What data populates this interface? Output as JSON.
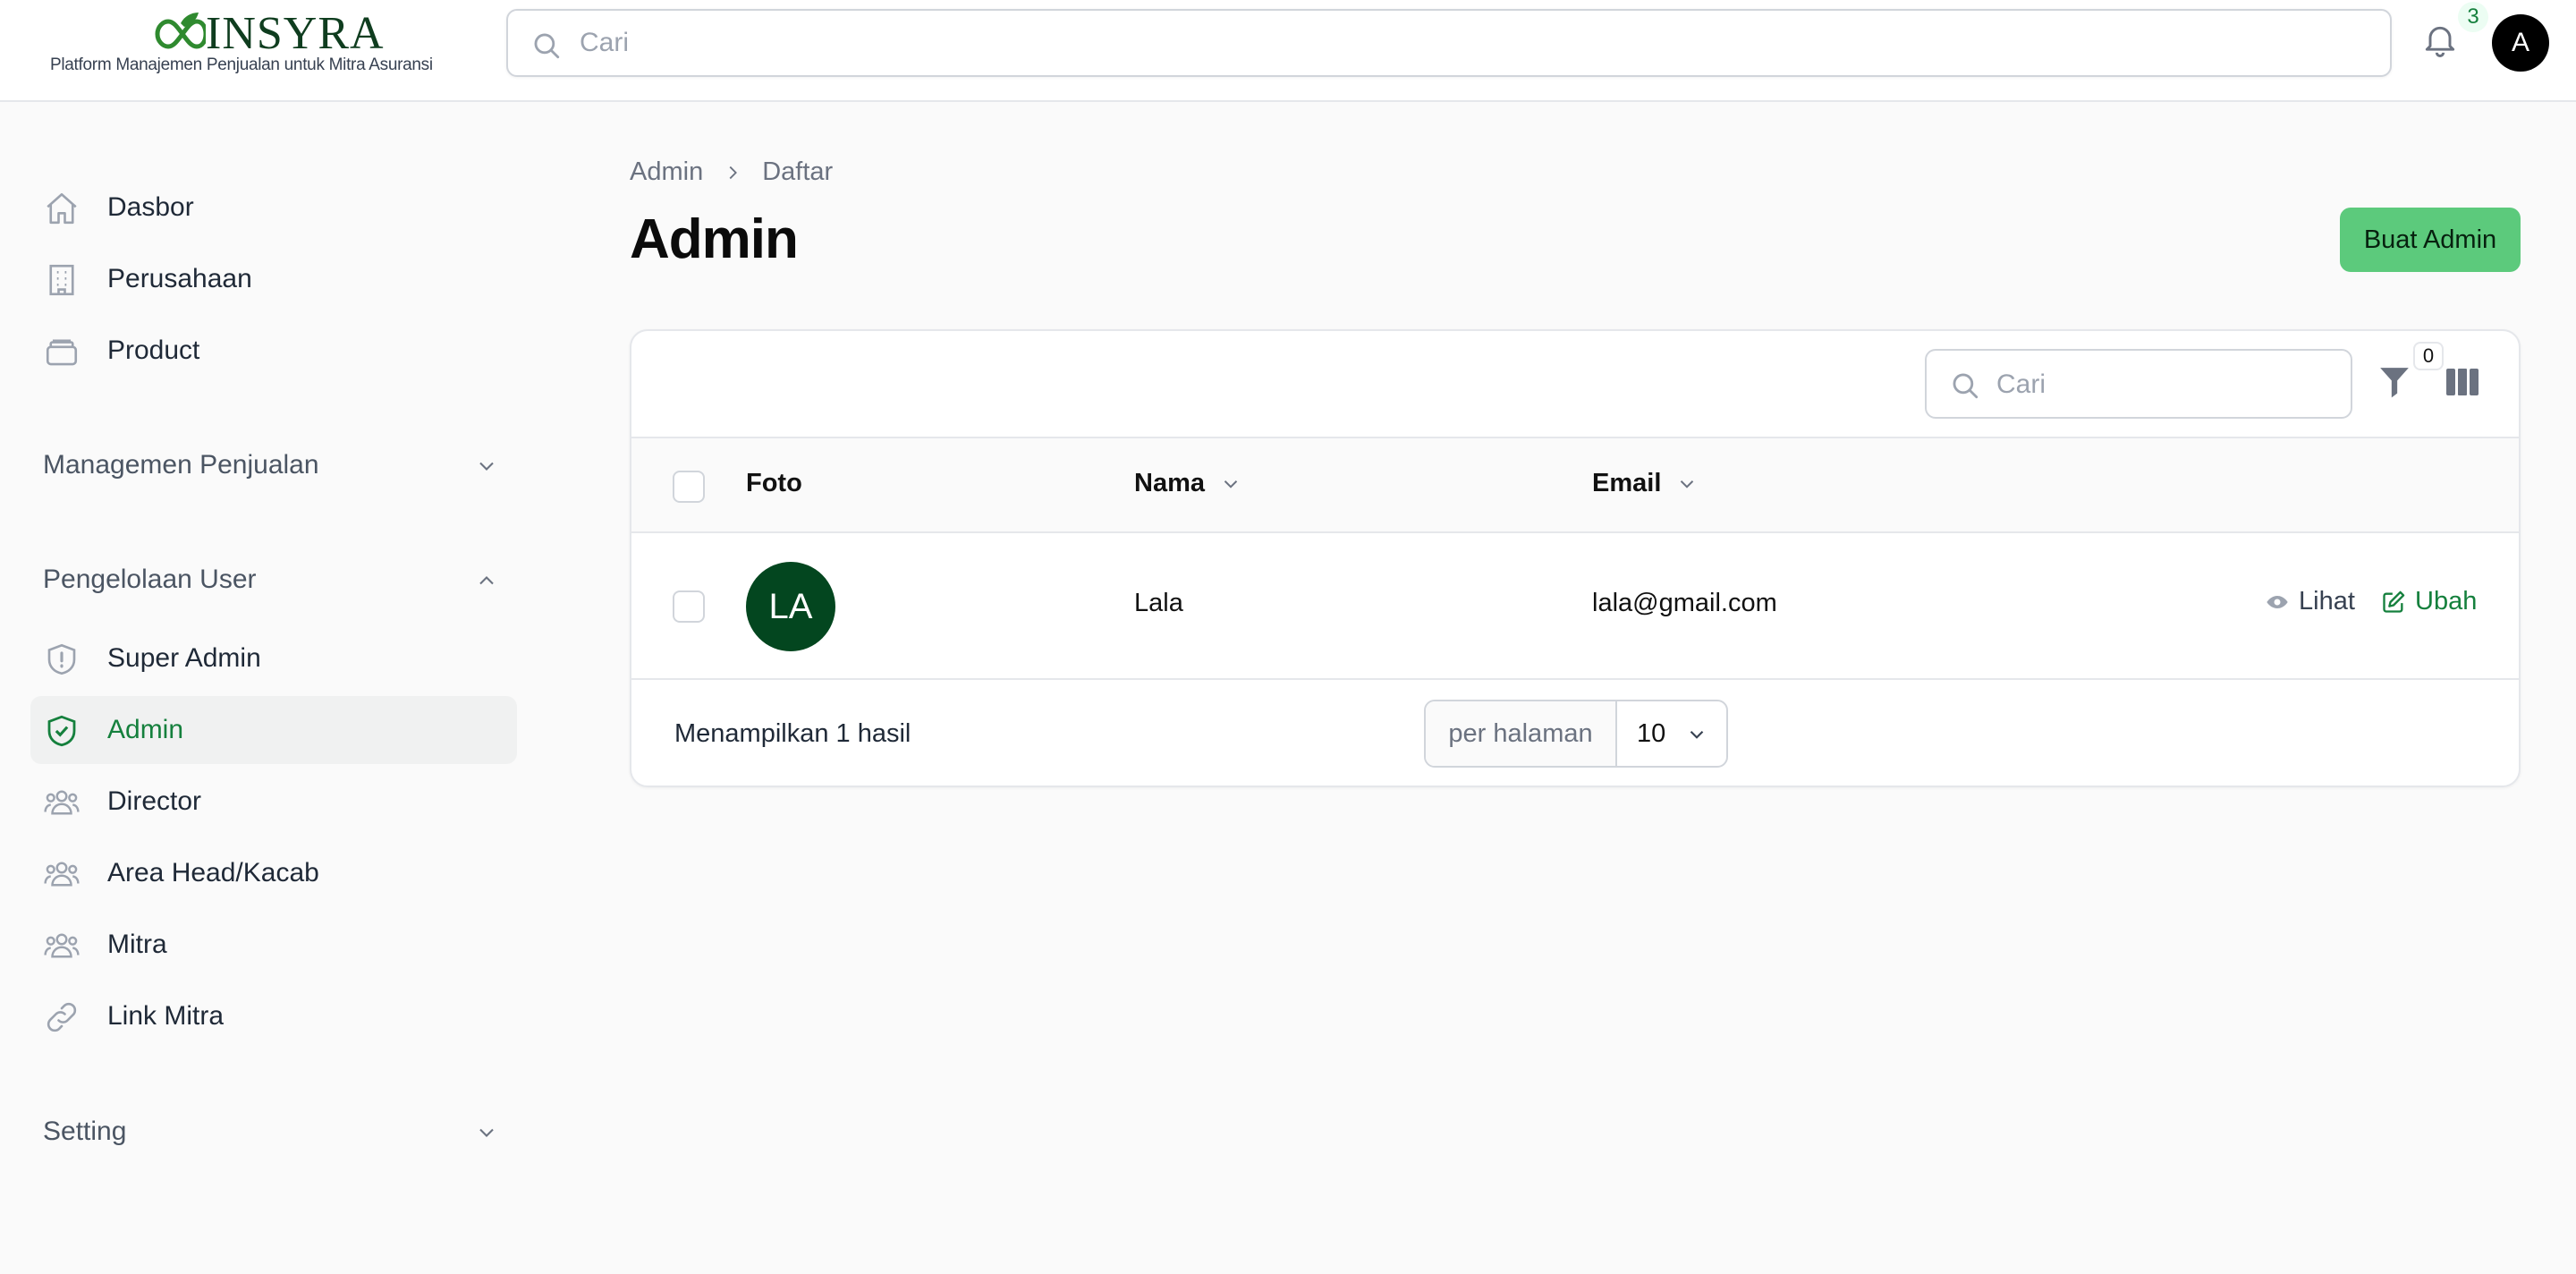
{
  "brand": {
    "name": "INSYRA",
    "tagline": "Platform Manajemen Penjualan untuk Mitra Asuransi",
    "color": "#0f3d1f"
  },
  "header": {
    "search_placeholder": "Cari",
    "notification_count": "3",
    "user_initial": "A"
  },
  "sidebar": {
    "top_items": [
      {
        "label": "Dasbor",
        "icon": "home-icon"
      },
      {
        "label": "Perusahaan",
        "icon": "building-icon"
      },
      {
        "label": "Product",
        "icon": "box-icon"
      }
    ],
    "groups": [
      {
        "label": "Managemen Penjualan",
        "expanded": false
      },
      {
        "label": "Pengelolaan User",
        "expanded": true
      },
      {
        "label": "Setting",
        "expanded": false
      }
    ],
    "user_items": [
      {
        "label": "Super Admin",
        "icon": "shield-exclamation-icon",
        "active": false
      },
      {
        "label": "Admin",
        "icon": "shield-check-icon",
        "active": true
      },
      {
        "label": "Director",
        "icon": "user-group-icon",
        "active": false
      },
      {
        "label": "Area Head/Kacab",
        "icon": "user-group-icon",
        "active": false
      },
      {
        "label": "Mitra",
        "icon": "user-group-icon",
        "active": false
      },
      {
        "label": "Link Mitra",
        "icon": "link-icon",
        "active": false
      }
    ],
    "active_color": "#15803d"
  },
  "breadcrumb": [
    "Admin",
    "Daftar"
  ],
  "page": {
    "title": "Admin",
    "create_button": "Buat Admin",
    "button_color": "#5cca7c"
  },
  "table": {
    "search_placeholder": "Cari",
    "filter_count": "0",
    "columns": [
      "Foto",
      "Nama",
      "Email"
    ],
    "rows": [
      {
        "initials": "LA",
        "name": "Lala",
        "email": "lala@gmail.com",
        "avatar_color": "#03461f"
      }
    ],
    "actions": {
      "view": "Lihat",
      "edit": "Ubah"
    },
    "result_text": "Menampilkan 1 hasil",
    "per_page_label": "per halaman",
    "per_page_value": "10"
  }
}
